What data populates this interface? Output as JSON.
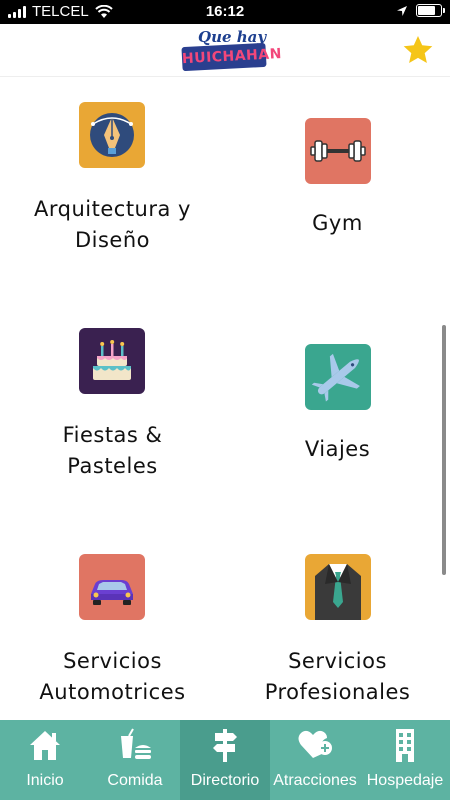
{
  "status_bar": {
    "carrier": "TELCEL",
    "time": "16:12",
    "battery_level": 0.75
  },
  "header": {
    "logo_top": "Que hay",
    "logo_main": "HUICHAHAN",
    "favorite_icon": "star-icon",
    "accent_color": "#f5c518"
  },
  "categories": [
    {
      "label": "Arquitectura y Diseño",
      "icon": "pen-tool-icon",
      "bg": "#e9a735"
    },
    {
      "label": "Gym",
      "icon": "dumbbell-icon",
      "bg": "#e07563"
    },
    {
      "label": "Fiestas & Pasteles",
      "icon": "cake-icon",
      "bg": "#3a2150"
    },
    {
      "label": "Viajes",
      "icon": "airplane-icon",
      "bg": "#3aa68f"
    },
    {
      "label": "Servicios Automotrices",
      "icon": "car-icon",
      "bg": "#e07563"
    },
    {
      "label": "Servicios Profesionales",
      "icon": "suit-tie-icon",
      "bg": "#e9a735"
    }
  ],
  "bottom_nav": {
    "active": "Directorio",
    "items": [
      {
        "label": "Inicio",
        "icon": "home-icon"
      },
      {
        "label": "Comida",
        "icon": "food-icon"
      },
      {
        "label": "Directorio",
        "icon": "signpost-icon"
      },
      {
        "label": "Atracciones",
        "icon": "heart-plus-icon"
      },
      {
        "label": "Hospedaje",
        "icon": "building-icon"
      }
    ],
    "bg_color": "#5db3a2",
    "active_color": "#4a9d8d"
  }
}
